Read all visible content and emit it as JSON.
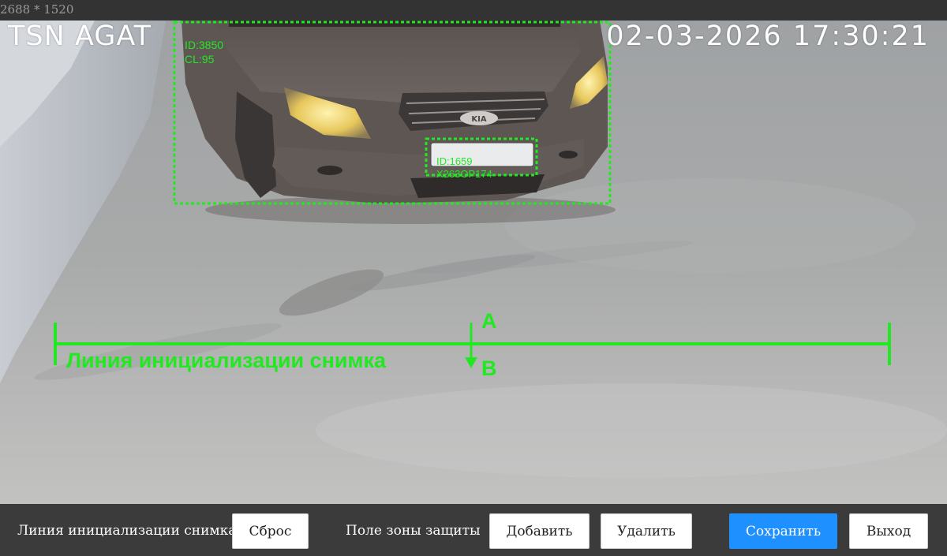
{
  "resolution_label": "2688 * 1520",
  "osd": {
    "camera_name": "TSN AGAT",
    "timestamp": "02-03-2026 17:30:21"
  },
  "detections": {
    "vehicle": {
      "id": "ID:3850",
      "cl": "CL:95"
    },
    "plate": {
      "id": "ID:1659",
      "number": "X263OP174"
    },
    "plate_visible_text": "X263OP174"
  },
  "overlay": {
    "line_label": "Линия инициализации снимка",
    "point_a": "A",
    "point_b": "B"
  },
  "toolbar": {
    "line_label": "Линия инициализации снимка",
    "reset_label": "Сброс",
    "zone_label": "Поле зоны защиты",
    "add_label": "Добавить",
    "delete_label": "Удалить",
    "save_label": "Сохранить",
    "exit_label": "Выход"
  },
  "colors": {
    "overlay_green": "#22e822",
    "primary_button": "#1e90ff",
    "toolbar_bg": "#3b3b3b"
  }
}
